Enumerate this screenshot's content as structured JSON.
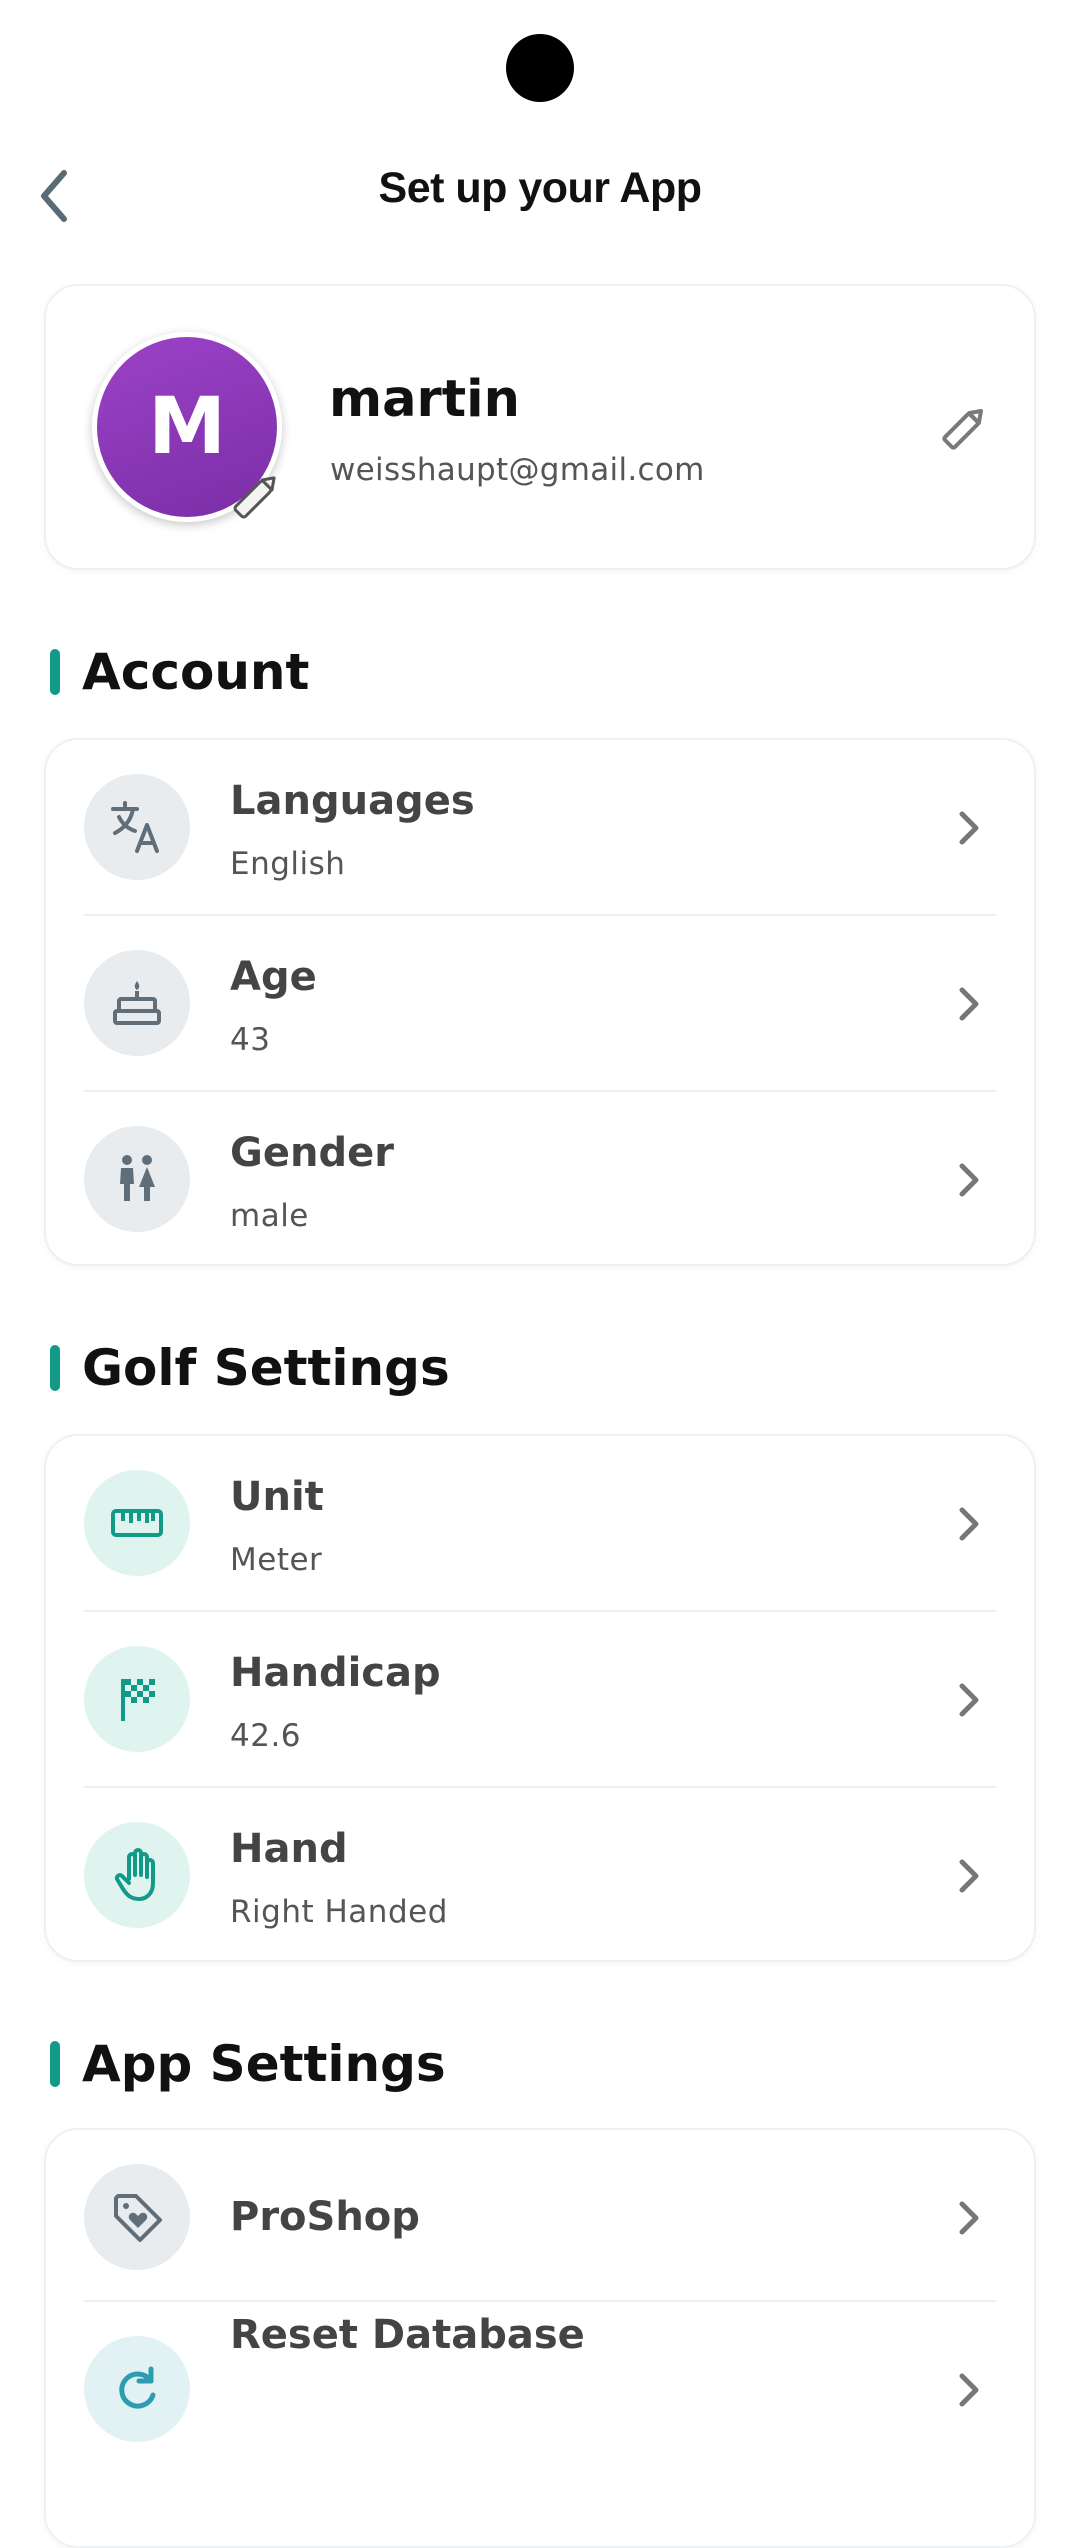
{
  "header": {
    "title": "Set up your App"
  },
  "profile": {
    "initial": "M",
    "name": "martin",
    "email": "weisshaupt@gmail.com"
  },
  "sections": {
    "account": {
      "title": "Account",
      "items": [
        {
          "label": "Languages",
          "value": "English",
          "icon": "translate-icon"
        },
        {
          "label": "Age",
          "value": "43",
          "icon": "cake-icon"
        },
        {
          "label": "Gender",
          "value": "male",
          "icon": "people-icon"
        }
      ]
    },
    "golf": {
      "title": "Golf Settings",
      "items": [
        {
          "label": "Unit",
          "value": "Meter",
          "icon": "ruler-icon"
        },
        {
          "label": "Handicap",
          "value": "42.6",
          "icon": "flag-icon"
        },
        {
          "label": "Hand",
          "value": "Right Handed",
          "icon": "hand-icon"
        }
      ]
    },
    "app": {
      "title": "App Settings",
      "items": [
        {
          "label": "ProShop",
          "icon": "tag-icon"
        },
        {
          "label": "Reset Database",
          "icon": "reset-icon"
        }
      ]
    }
  },
  "colors": {
    "accent": "#129a88",
    "avatar": "#8e3bbf"
  }
}
